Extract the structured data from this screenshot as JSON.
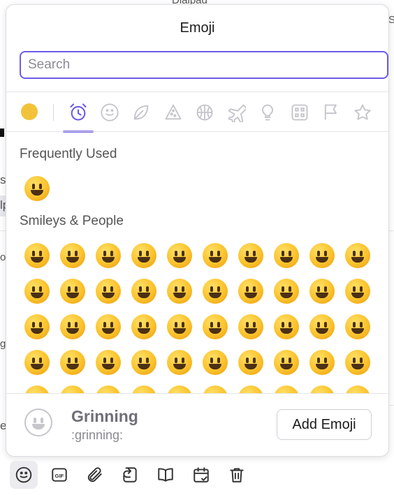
{
  "background": {
    "top_fragment": "Dialpad",
    "fragments": [
      "s",
      "lp",
      "o",
      "g",
      "er",
      "S"
    ]
  },
  "popover": {
    "title": "Emoji",
    "search": {
      "placeholder": "Search",
      "value": ""
    },
    "skin_tone_color": "#f2c33a",
    "accent_color": "#6b5ce7",
    "categories": [
      {
        "icon": "alarm-clock-icon",
        "active": true
      },
      {
        "icon": "smiley-face-icon",
        "active": false
      },
      {
        "icon": "leaf-icon",
        "active": false
      },
      {
        "icon": "pizza-icon",
        "active": false
      },
      {
        "icon": "basketball-icon",
        "active": false
      },
      {
        "icon": "airplane-icon",
        "active": false
      },
      {
        "icon": "lightbulb-icon",
        "active": false
      },
      {
        "icon": "symbols-icon",
        "active": false
      },
      {
        "icon": "flag-icon",
        "active": false
      },
      {
        "icon": "star-icon",
        "active": false
      }
    ],
    "sections": [
      {
        "title": "Frequently Used",
        "emoji_count": 1
      },
      {
        "title": "Smileys & People",
        "emoji_count": 50
      }
    ],
    "preview": {
      "name": "Grinning",
      "shortcode": ":grinning:"
    },
    "add_button_label": "Add Emoji"
  },
  "toolbar": {
    "buttons": [
      {
        "icon": "emoji-icon",
        "active": true
      },
      {
        "icon": "gif-icon",
        "label": "GIF",
        "active": false
      },
      {
        "icon": "paperclip-icon",
        "active": false
      },
      {
        "icon": "reply-icon",
        "active": false
      },
      {
        "icon": "book-icon",
        "active": false
      },
      {
        "icon": "calendar-check-icon",
        "active": false
      },
      {
        "icon": "trash-icon",
        "active": false
      }
    ]
  }
}
